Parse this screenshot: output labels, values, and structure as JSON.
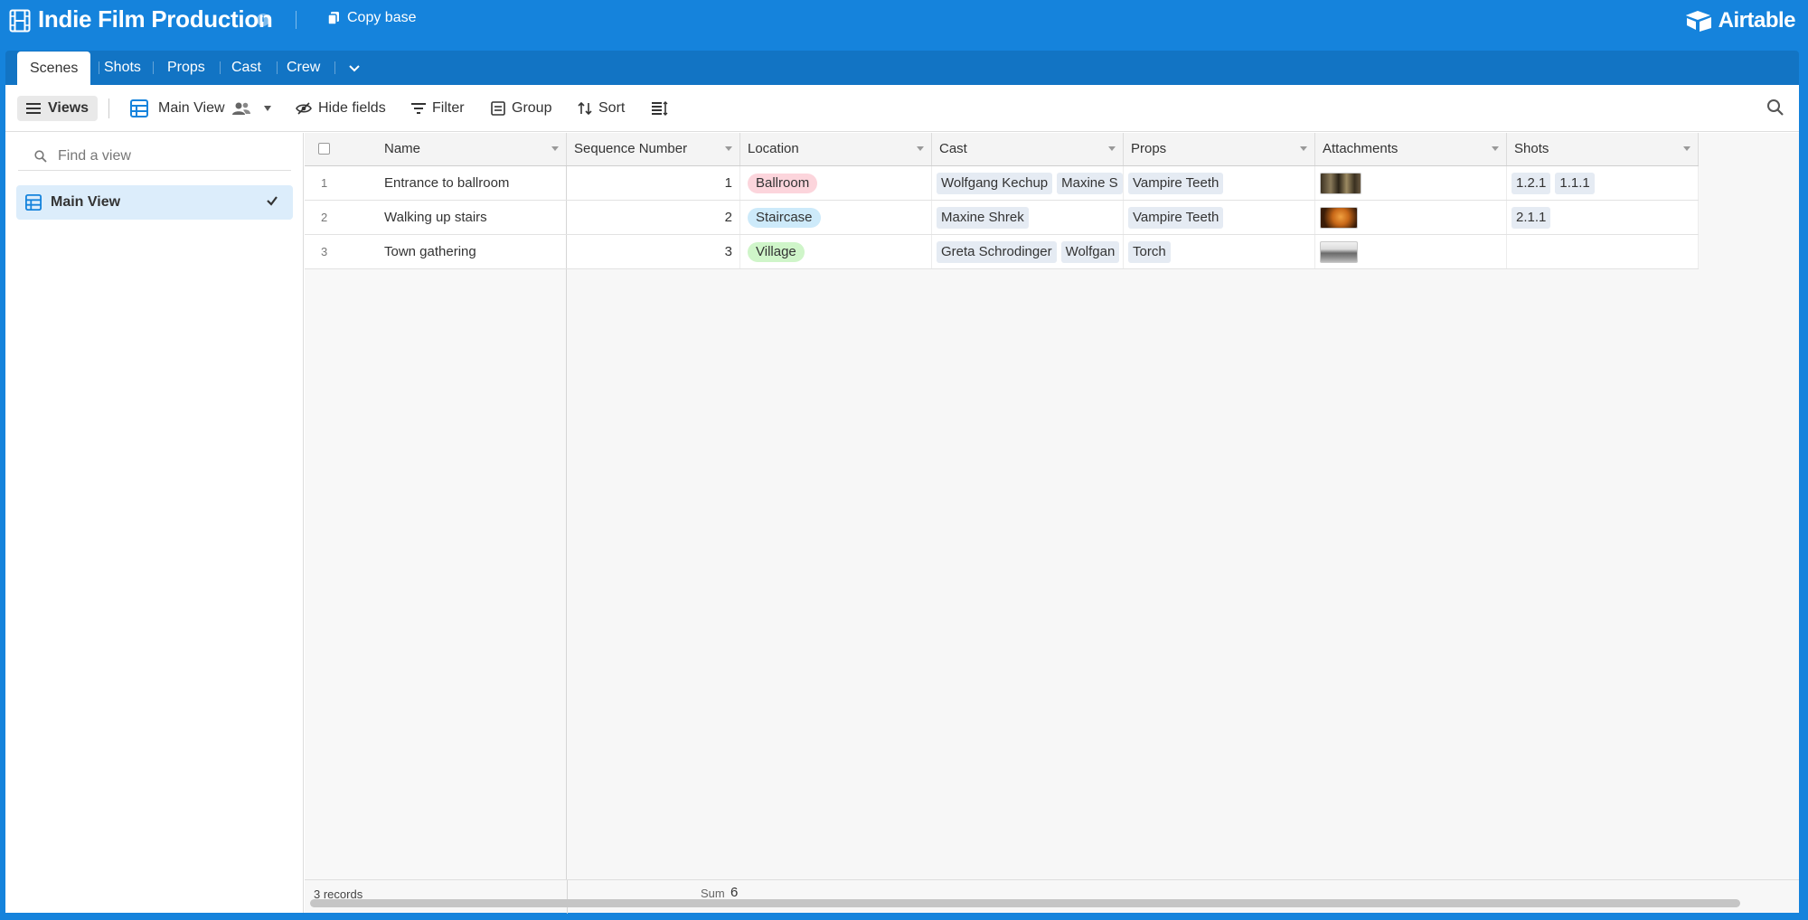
{
  "app": {
    "base_title": "Indie Film Production",
    "copy_label": "Copy base",
    "brand": "Airtable"
  },
  "tabs": [
    {
      "label": "Scenes",
      "active": true
    },
    {
      "label": "Shots",
      "active": false
    },
    {
      "label": "Props",
      "active": false
    },
    {
      "label": "Cast",
      "active": false
    },
    {
      "label": "Crew",
      "active": false
    }
  ],
  "toolbar": {
    "views_label": "Views",
    "view_name": "Main View",
    "hide_fields": "Hide fields",
    "filter": "Filter",
    "group": "Group",
    "sort": "Sort"
  },
  "sidebar": {
    "find_placeholder": "Find a view",
    "views": [
      {
        "name": "Main View",
        "selected": true
      }
    ]
  },
  "grid": {
    "columns": [
      "Name",
      "Sequence Number",
      "Location",
      "Cast",
      "Props",
      "Attachments",
      "Shots"
    ],
    "rows": [
      {
        "num": "1",
        "name": "Entrance to ballroom",
        "sequence": "1",
        "location": "Ballroom",
        "location_color": "#fcd5dc",
        "cast": [
          "Wolfgang Kechup",
          "Maxine S"
        ],
        "props": [
          "Vampire Teeth"
        ],
        "attachment": "thumb-dark-room",
        "shots": [
          "1.2.1",
          "1.1.1"
        ]
      },
      {
        "num": "2",
        "name": "Walking up stairs",
        "sequence": "2",
        "location": "Staircase",
        "location_color": "#cdeafa",
        "cast": [
          "Maxine Shrek"
        ],
        "props": [
          "Vampire Teeth"
        ],
        "attachment": "thumb-orange-silhouette",
        "shots": [
          "2.1.1"
        ]
      },
      {
        "num": "3",
        "name": "Town gathering",
        "sequence": "3",
        "location": "Village",
        "location_color": "#cff5c9",
        "cast": [
          "Greta Schrodinger",
          "Wolfgan"
        ],
        "props": [
          "Torch"
        ],
        "attachment": "thumb-grey-village",
        "shots": []
      }
    ],
    "footer": {
      "records": "3 records",
      "sum_label": "Sum",
      "sum_value": "6"
    }
  },
  "colors": {
    "brand_blue": "#1583dc",
    "tab_bar": "#1274c4",
    "view_selected": "#dcedfb"
  }
}
